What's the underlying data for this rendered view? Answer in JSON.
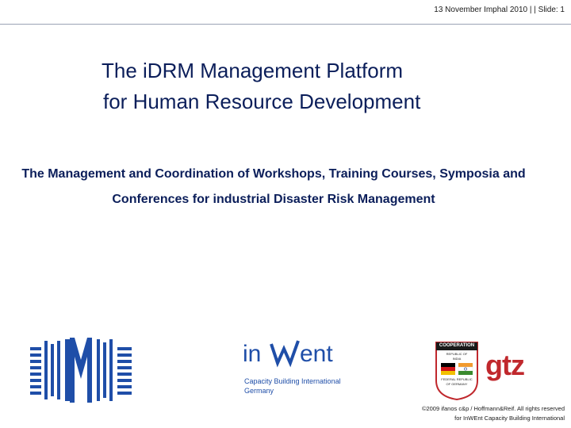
{
  "header": {
    "text": "13 November Imphal 2010 |  | Slide: 1"
  },
  "title": {
    "line1": "The iDRM Management Platform",
    "line2": "for Human Resource Development"
  },
  "subtitle": "The Management and Coordination of Workshops, Training Courses, Symposia and Conferences for industrial Disaster Risk Management",
  "logos": {
    "inwent_tagline_1": "Capacity Building International",
    "inwent_tagline_2": "Germany",
    "coop_title": "COOPERATION",
    "coop_1": "REPUBLIC OF",
    "coop_2": "INDIA",
    "coop_3": "FEDERAL REPUBLIC",
    "coop_4": "OF GERMANY",
    "gtz": "gtz"
  },
  "footer": {
    "line1": "©2009 ifanos c&p / Hoffmann&Reif. All rights reserved",
    "line2": "for InWEnt Capacity Building International"
  },
  "colors": {
    "text": "#0b1e5a",
    "logo_blue": "#1f4ea8",
    "gtz_red": "#c0282d"
  }
}
